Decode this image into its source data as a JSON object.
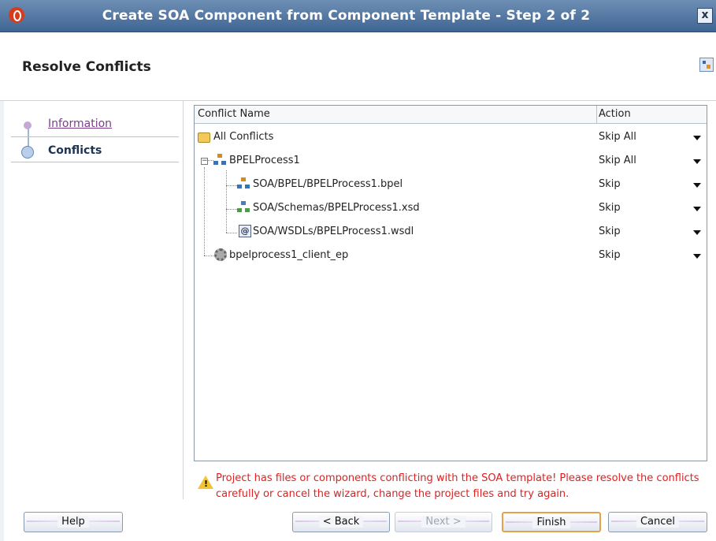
{
  "window": {
    "title": "Create SOA Component from Component Template - Step 2 of 2",
    "close_symbol": "x"
  },
  "header": {
    "title": "Resolve Conflicts"
  },
  "steps": [
    {
      "label": "Information"
    },
    {
      "label": "Conflicts"
    }
  ],
  "table": {
    "columns": [
      "Conflict Name",
      "Action"
    ],
    "rows": [
      {
        "name": "All Conflicts",
        "action": "Skip All"
      },
      {
        "name": "BPELProcess1",
        "action": "Skip All",
        "expander": "−"
      },
      {
        "name": "SOA/BPEL/BPELProcess1.bpel",
        "action": "Skip"
      },
      {
        "name": "SOA/Schemas/BPELProcess1.xsd",
        "action": "Skip"
      },
      {
        "name": "SOA/WSDLs/BPELProcess1.wsdl",
        "action": "Skip",
        "icon_text": "@"
      },
      {
        "name": "bpelprocess1_client_ep",
        "action": "Skip"
      }
    ]
  },
  "warning": {
    "text": "Project has files or components conflicting with the SOA template! Please resolve the conflicts carefully or cancel the wizard, change the project files and try again.",
    "icon_text": "!"
  },
  "buttons": {
    "help": "Help",
    "back": "< Back",
    "next": "Next >",
    "finish": "Finish",
    "cancel": "Cancel"
  }
}
